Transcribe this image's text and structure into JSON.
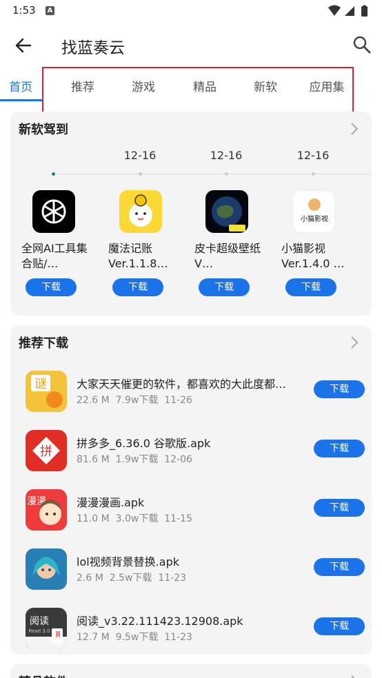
{
  "status_bar": {
    "time": "1:53",
    "notification_letter": "A"
  },
  "app_bar": {
    "title": "找蓝奏云"
  },
  "tabs": [
    {
      "label": "首页",
      "active": true
    },
    {
      "label": "推荐",
      "active": false
    },
    {
      "label": "游戏",
      "active": false
    },
    {
      "label": "精品",
      "active": false
    },
    {
      "label": "新软",
      "active": false
    },
    {
      "label": "应用集",
      "active": false
    }
  ],
  "new_software": {
    "title": "新软驾到",
    "dates": [
      "12-16",
      "12-16",
      "12-16"
    ],
    "download_label": "下载",
    "apps": [
      {
        "name": "全网AI工具集合贴/…",
        "icon": "openai-icon"
      },
      {
        "name": "魔法记账Ver.1.1.8…",
        "icon": "lucky-cat-icon"
      },
      {
        "name": "皮卡超级壁纸 V…",
        "icon": "earth-wallpaper-icon"
      },
      {
        "name": "小猫影视Ver.1.4.0 …",
        "icon": "cat-video-icon",
        "icon_text": "小猫影视"
      }
    ]
  },
  "recommended": {
    "title": "推荐下载",
    "download_label": "下载",
    "items": [
      {
        "name": "大家天天催更的软件，都喜欢的大此度都…",
        "size": "22.6 M",
        "downloads": "7.9w下载",
        "date": "11-26",
        "icon": "yellow-app-icon",
        "icon_text": "谜"
      },
      {
        "name": "拼多多_6.36.0 谷歌版.apk",
        "size": "81.6 M",
        "downloads": "1.9w下载",
        "date": "12-06",
        "icon": "pinduoduo-icon",
        "icon_text": "拼"
      },
      {
        "name": "漫漫漫画.apk",
        "size": "11.0 M",
        "downloads": "3.0w下载",
        "date": "11-15",
        "icon": "manman-comic-icon",
        "icon_text": "漫漫"
      },
      {
        "name": "lol视频背景替换.apk",
        "size": "2.6 M",
        "downloads": "2.5w下载",
        "date": "11-23",
        "icon": "lol-character-icon"
      },
      {
        "name": "阅读_v3.22.111423.12908.apk",
        "size": "12.7 M",
        "downloads": "9.5w下载",
        "date": "11-23",
        "icon": "read-book-icon",
        "icon_text": "阅读",
        "icon_subtext": "Read 3.0"
      }
    ]
  },
  "next_section": {
    "title": "精品软件"
  },
  "colors": {
    "accent": "#1a73e8",
    "highlight_border": "#e0202a",
    "card_bg": "#f4f4f4",
    "timeline_active": "#138a8a"
  }
}
